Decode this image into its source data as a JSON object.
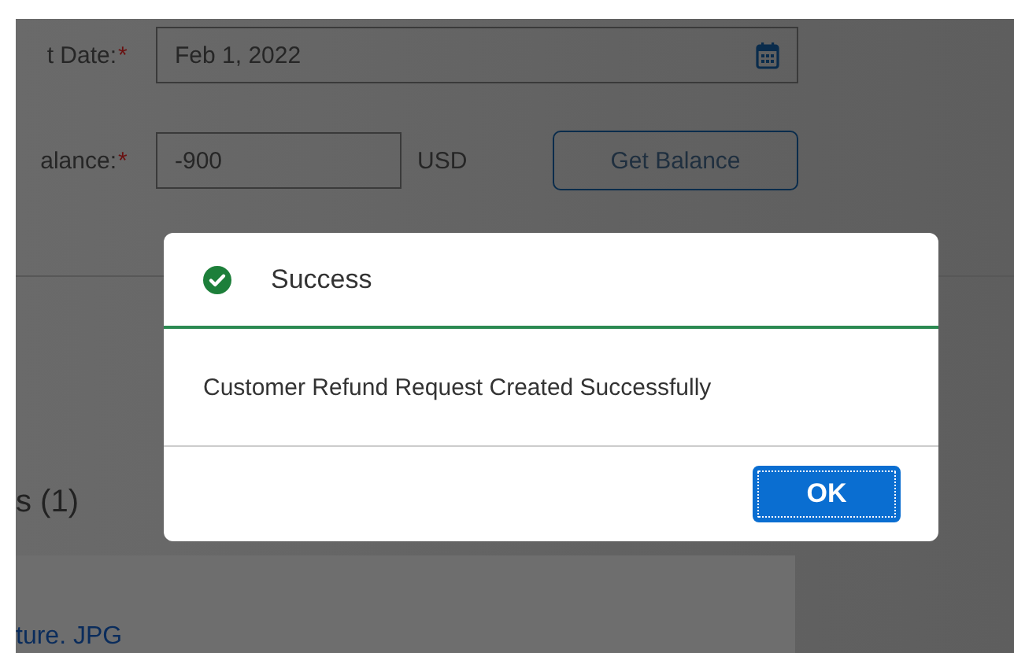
{
  "form": {
    "required_mark": "*",
    "fields": [
      {
        "label": "t Date:",
        "required": true,
        "kind": "date",
        "value": "Feb 1, 2022"
      },
      {
        "label": "alance:",
        "required": true,
        "kind": "amount",
        "value": "-900",
        "currency": "USD",
        "button": "Get Balance"
      }
    ]
  },
  "attachments": {
    "title": "s (1)",
    "link": "ture. JPG"
  },
  "dialog": {
    "title": "Success",
    "kind": "success",
    "message": "Customer Refund Request Created Successfully",
    "buttons": [
      "OK"
    ]
  }
}
